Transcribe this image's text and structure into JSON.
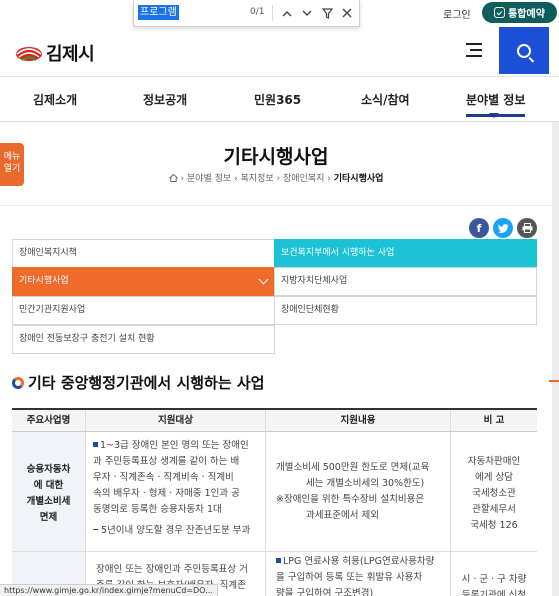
{
  "findbar": {
    "query": "프로그램",
    "count": "0/1"
  },
  "util": {
    "login": "로그인",
    "reserve": "통합예약"
  },
  "logo": {
    "text": "김제시"
  },
  "gnb": {
    "items": [
      {
        "label": "김제소개"
      },
      {
        "label": "정보공개"
      },
      {
        "label": "민원365"
      },
      {
        "label": "소식/참여"
      },
      {
        "label": "분야별 정보"
      }
    ]
  },
  "side_tab": {
    "line1": "메뉴",
    "line2": "열기"
  },
  "page": {
    "title": "기타시행사업"
  },
  "breadcrumb": {
    "items": [
      "분야별 정보",
      "복지정보",
      "장애인복지"
    ],
    "current": "기타시행사업"
  },
  "submenu": [
    {
      "label": "장애인복지시책"
    },
    {
      "label": "보건복지부에서 시행하는 사업"
    },
    {
      "label": "기타시행사업"
    },
    {
      "label": "지방자치단체사업"
    },
    {
      "label": "민간기관지원사업"
    },
    {
      "label": "장애인단체현황"
    },
    {
      "label": "장애인 전동보장구 충전기 설치 현황"
    }
  ],
  "section": {
    "title": "기타 중앙행정기관에서 시행하는 사업"
  },
  "table": {
    "headers": [
      "주요사업명",
      "지원대상",
      "지원내용",
      "비 고"
    ],
    "rows": [
      {
        "name": [
          "승용자동차",
          "에 대한",
          "개별소비세",
          "면제"
        ],
        "target": [
          "1~3급 장애인 본인 명의 또는 장애인",
          "과 주민등록표상 생계를 같이 하는 배",
          "우자 · 직계존속 · 직계비속 · 직계비",
          "속의 배우자 · 형제 · 자매중 1인과 공",
          "동명의로 등록한 승용자동차 1대"
        ],
        "target_note": "5년이내 양도할 경우 잔존년도분 부과",
        "support": [
          "개별소비세 500만원 한도로 면제(교육",
          "세는 개별소비세의 30%한도)",
          "※장애인을 위한 특수장비 설치비용은",
          "과세표준에서 제외"
        ],
        "note": [
          "자동차판매인",
          "에게 상담",
          "국세청소관",
          "관할세무서",
          "국세청 126"
        ]
      },
      {
        "target": [
          "장애인 또는 장애인과 주민등록표상 거",
          "주를 같이 하는 보호자(배우자, 직계존"
        ],
        "support": [
          "LPG 연료사용 허용(LPG연료사용차량",
          "을 구입하여 등록 또는 휘발유 사용차",
          "량을 구입하여 구조변경)"
        ],
        "note": [
          "시 · 군 · 구 차량",
          "등록기관에 신청"
        ]
      }
    ]
  },
  "status": {
    "url": "https://www.gimje.go.kr/index.gimje?menuCd=DO..."
  },
  "colors": {
    "primary": "#1a4fd6",
    "teal": "#1cc2d6",
    "orange": "#ef6b2c",
    "navy": "#1c3e8c",
    "reserve": "#0f5d5a"
  }
}
